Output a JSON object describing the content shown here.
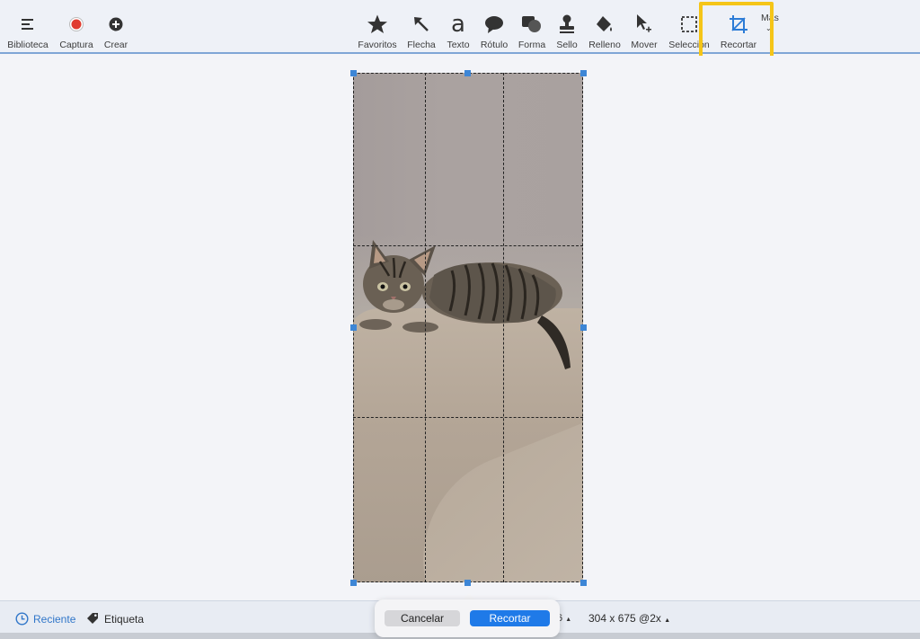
{
  "toolbar": {
    "left_tools": [
      {
        "label": "Biblioteca",
        "icon": "hamburger-icon"
      },
      {
        "label": "Captura",
        "icon": "record-icon"
      },
      {
        "label": "Crear",
        "icon": "plus-circle-icon"
      }
    ],
    "tools": [
      {
        "label": "Favoritos",
        "icon": "star-icon"
      },
      {
        "label": "Flecha",
        "icon": "arrow-icon"
      },
      {
        "label": "Texto",
        "icon": "text-icon"
      },
      {
        "label": "Rótulo",
        "icon": "speech-bubble-icon"
      },
      {
        "label": "Forma",
        "icon": "shape-icon"
      },
      {
        "label": "Sello",
        "icon": "stamp-icon"
      },
      {
        "label": "Relleno",
        "icon": "fill-bucket-icon"
      },
      {
        "label": "Mover",
        "icon": "move-cursor-icon"
      },
      {
        "label": "Selección",
        "icon": "selection-icon"
      },
      {
        "label": "Recortar",
        "icon": "crop-icon"
      }
    ],
    "more_label": "Más",
    "highlight_color": "#f5c518",
    "text_glyph": "a"
  },
  "bottom": {
    "recent_label": "Reciente",
    "tag_label": "Etiqueta",
    "zoom_tail": "6",
    "dimensions": "304 x 675 @2x"
  },
  "crop_popup": {
    "cancel_label": "Cancelar",
    "crop_label": "Recortar"
  },
  "colors": {
    "accent": "#1f7ae8",
    "record": "#e03b2f"
  }
}
